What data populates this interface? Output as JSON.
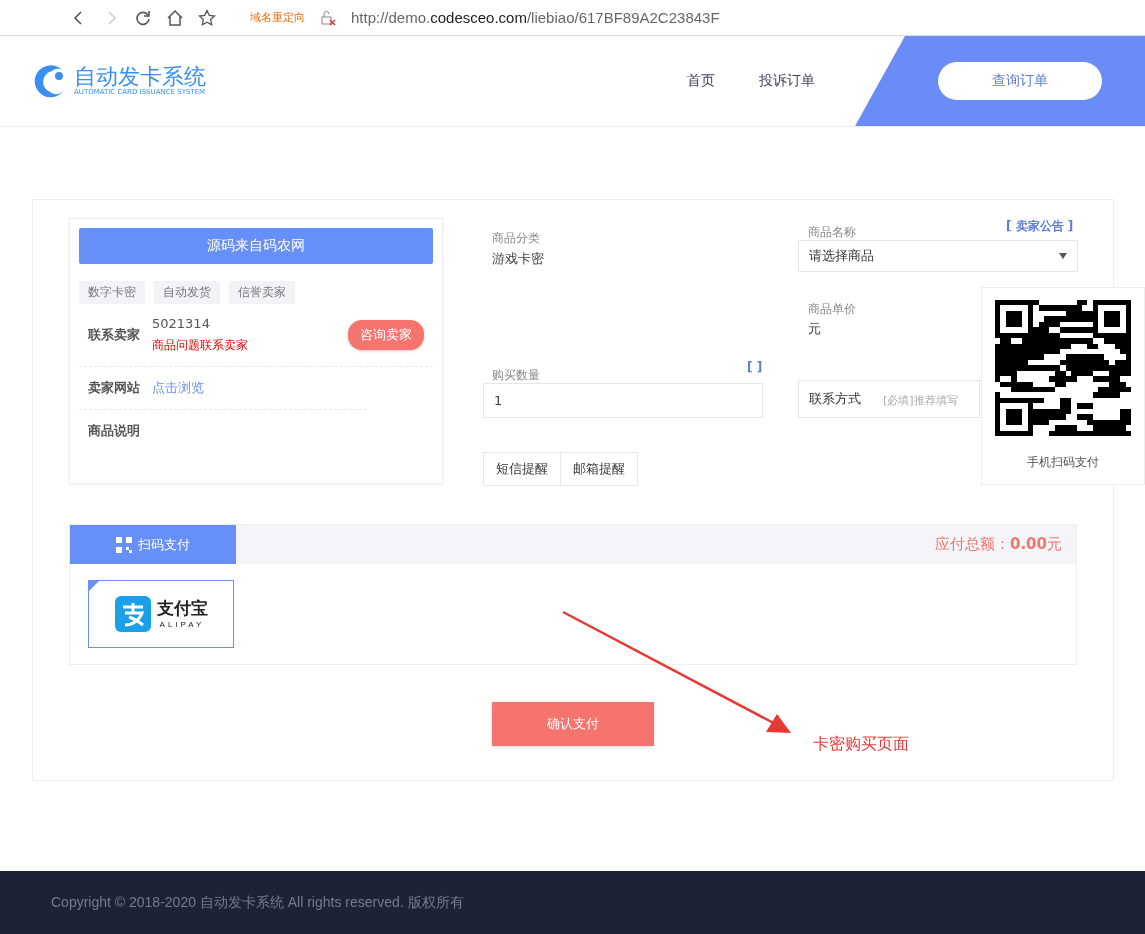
{
  "browser": {
    "redirect_label": "域名重定向",
    "url_host_prefix": "http://demo.",
    "url_host": "codesceo.com",
    "url_path": "/liebiao/617BF89A2C23843F"
  },
  "header": {
    "logo_title": "自动发卡系统",
    "logo_subtitle": "AUTOMATIC CARD ISSUANCE SYSTEM",
    "nav": [
      {
        "label": "首页"
      },
      {
        "label": "投诉订单"
      }
    ],
    "query_button": "查询订单"
  },
  "seller": {
    "banner": "源码来自码农网",
    "tags": [
      "数字卡密",
      "自动发货",
      "信誉卖家"
    ],
    "contact_label": "联系卖家",
    "contact_value": "5021314",
    "contact_note": "商品问题联系卖家",
    "consult_button": "咨询卖家",
    "site_label": "卖家网站",
    "site_link": "点击浏览",
    "desc_label": "商品说明"
  },
  "form": {
    "notice_link": "[ 卖家公告 ]",
    "category_label": "商品分类",
    "category_value": "游戏卡密",
    "name_label": "商品名称",
    "name_placeholder": "请选择商品",
    "price_label": "商品单价",
    "price_value": "元",
    "stock_link": "[ ]",
    "qty_label": "购买数量",
    "qty_value": "1",
    "contact_label": "联系方式",
    "contact_placeholder": "[必填]推荐填写",
    "reminders": [
      "短信提醒",
      "邮箱提醒"
    ]
  },
  "qr_panel": {
    "caption": "手机扫码支付"
  },
  "payment": {
    "tabs": [
      {
        "label": "扫码支付",
        "selected": true
      }
    ],
    "total_label": "应付总额：",
    "total_value": "0.00",
    "total_unit": "元",
    "methods": [
      {
        "name": "支付宝",
        "sub": "ALIPAY",
        "selected": true
      }
    ],
    "confirm_button": "确认支付"
  },
  "annotation": {
    "text": "卡密购买页面"
  },
  "footer": {
    "copyright": "Copyright © 2018-2020 自动发卡系统 All rights reserved. 版权所有"
  }
}
